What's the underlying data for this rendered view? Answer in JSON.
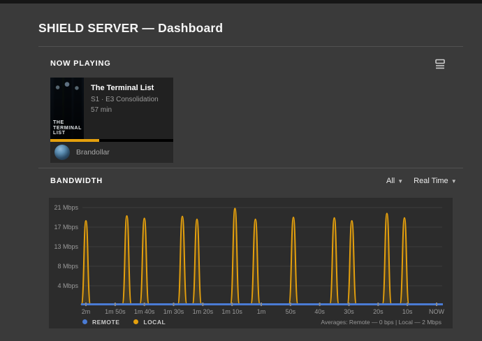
{
  "header": {
    "title": "SHIELD SERVER — Dashboard"
  },
  "now_playing": {
    "section_label": "NOW PLAYING",
    "card": {
      "poster_line1": "THE",
      "poster_line2": "TERMINAL",
      "poster_line3": "LIST",
      "title": "The Terminal List",
      "episode": "S1 · E3 Consolidation",
      "duration": "57 min",
      "progress_percent": 40,
      "user_name": "Brandollar"
    }
  },
  "bandwidth": {
    "section_label": "BANDWIDTH",
    "filter_source": "All",
    "filter_mode": "Real Time",
    "averages": "Averages: Remote — 0 bps | Local — 2 Mbps"
  },
  "chart_data": {
    "type": "line",
    "title": "BANDWIDTH",
    "grid": "horizontal gridlines on",
    "legend_position": "bottom-left",
    "x_axis": {
      "unit": "seconds ago (oldest at left, NOW at right)",
      "range_seconds_ago": [
        120,
        0
      ],
      "ticks": [
        {
          "label": "2m",
          "seconds_ago": 120
        },
        {
          "label": "1m 50s",
          "seconds_ago": 110
        },
        {
          "label": "1m 40s",
          "seconds_ago": 100
        },
        {
          "label": "1m 30s",
          "seconds_ago": 90
        },
        {
          "label": "1m 20s",
          "seconds_ago": 80
        },
        {
          "label": "1m 10s",
          "seconds_ago": 70
        },
        {
          "label": "1m",
          "seconds_ago": 60
        },
        {
          "label": "50s",
          "seconds_ago": 50
        },
        {
          "label": "40s",
          "seconds_ago": 40
        },
        {
          "label": "30s",
          "seconds_ago": 30
        },
        {
          "label": "20s",
          "seconds_ago": 20
        },
        {
          "label": "10s",
          "seconds_ago": 10
        },
        {
          "label": "NOW",
          "seconds_ago": 0
        }
      ]
    },
    "y_axis": {
      "min_mbps": 0,
      "ticks": [
        {
          "label": "21 Mbps",
          "mbps": 21
        },
        {
          "label": "17 Mbps",
          "mbps": 17
        },
        {
          "label": "13 Mbps",
          "mbps": 13
        },
        {
          "label": "8 Mbps",
          "mbps": 8
        },
        {
          "label": "4 Mbps",
          "mbps": 4
        }
      ]
    },
    "series": [
      {
        "name": "REMOTE",
        "color": "#4a7bd4",
        "shape": "constant",
        "constant_mbps": 0
      },
      {
        "name": "LOCAL",
        "color": "#e5a00d",
        "shape": "spikes",
        "baseline_mbps": 0,
        "spikes": [
          {
            "seconds_ago": 120,
            "peak_mbps": 18.3
          },
          {
            "seconds_ago": 106,
            "peak_mbps": 19.3
          },
          {
            "seconds_ago": 100,
            "peak_mbps": 18.8
          },
          {
            "seconds_ago": 87,
            "peak_mbps": 19.2
          },
          {
            "seconds_ago": 82,
            "peak_mbps": 18.6
          },
          {
            "seconds_ago": 69,
            "peak_mbps": 20.8
          },
          {
            "seconds_ago": 62,
            "peak_mbps": 18.6
          },
          {
            "seconds_ago": 49,
            "peak_mbps": 19.0
          },
          {
            "seconds_ago": 35,
            "peak_mbps": 18.9
          },
          {
            "seconds_ago": 29,
            "peak_mbps": 18.3
          },
          {
            "seconds_ago": 17,
            "peak_mbps": 19.8
          },
          {
            "seconds_ago": 11,
            "peak_mbps": 18.9
          }
        ]
      }
    ],
    "footer_note": "Averages: Remote — 0 bps | Local — 2 Mbps"
  }
}
